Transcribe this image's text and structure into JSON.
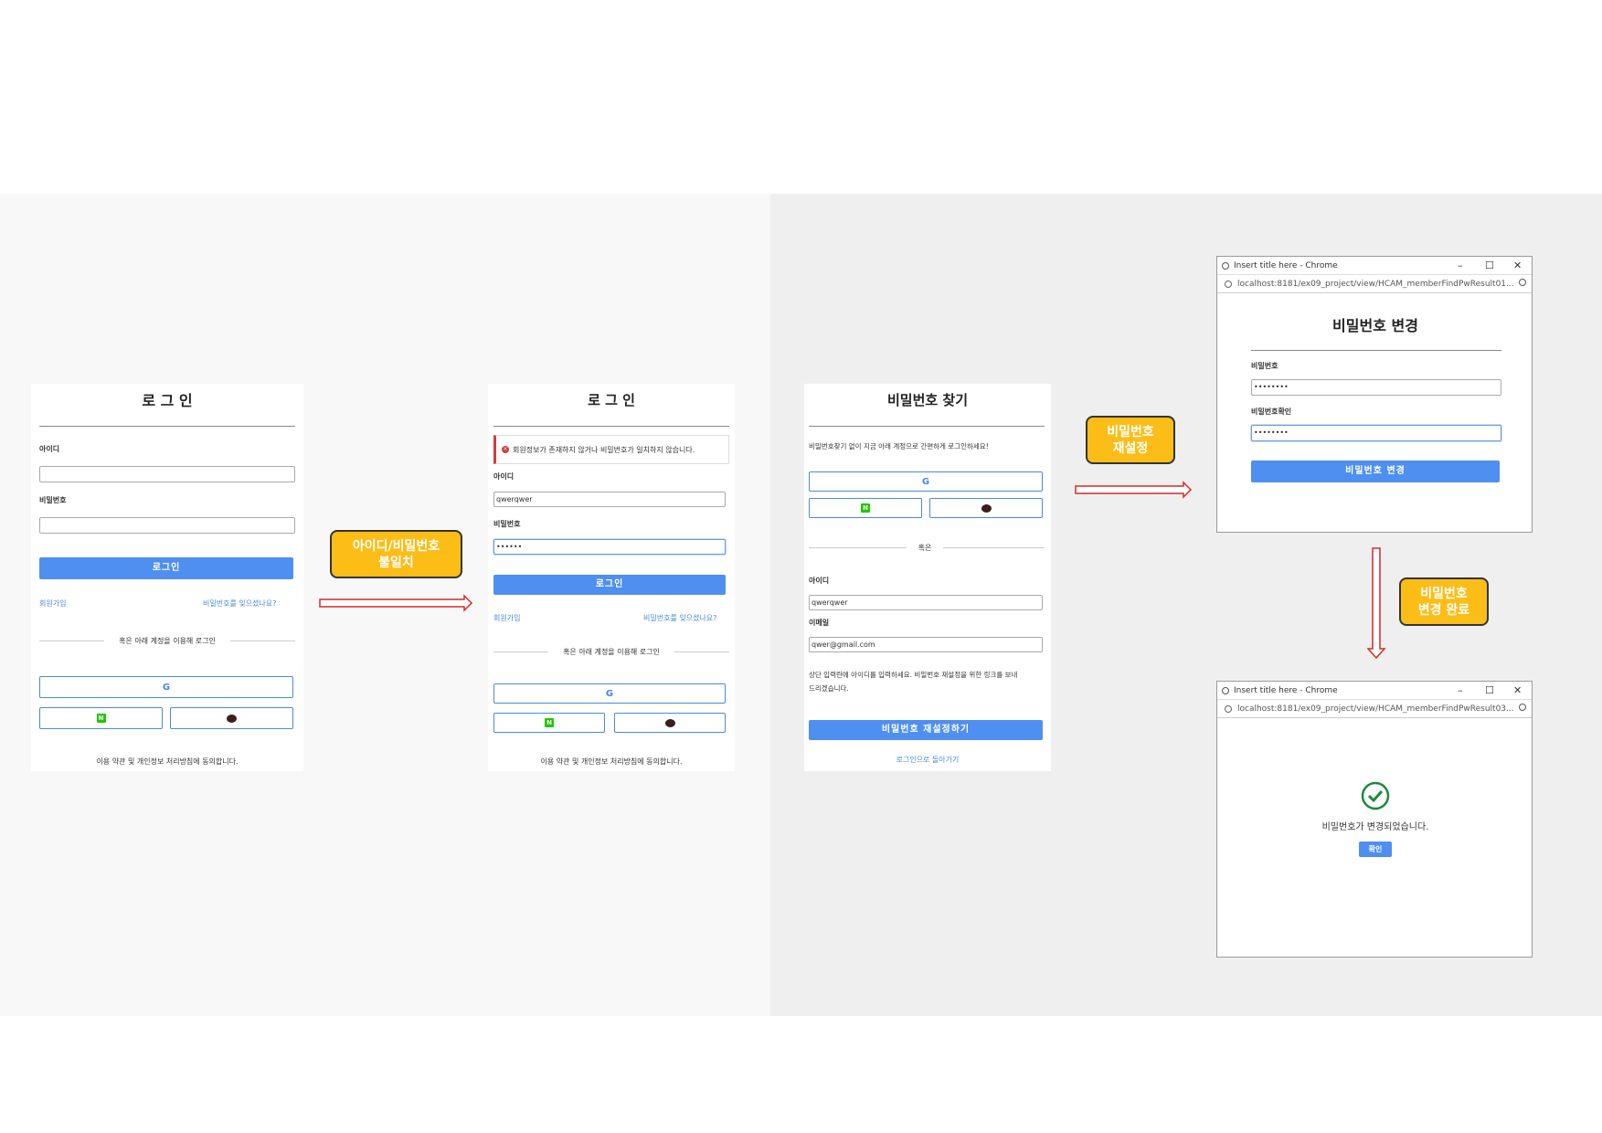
{
  "panel1": {
    "title": "로 그 인",
    "id_label": "아이디",
    "pw_label": "비밀번호",
    "login_button": "로그인",
    "signup_link": "회원가입",
    "forgot_link": "비밀번호를 잊으셨나요?",
    "or_text": "혹은 아래 계정을 이용해 로그인",
    "footer": "이용 약관 및 개인정보 처리방침에 동의합니다."
  },
  "panel2": {
    "title": "로 그 인",
    "error_message": "회원정보가 존재하지 않거나 비밀번호가 일치하지 않습니다.",
    "id_label": "아이디",
    "id_value": "qwerqwer",
    "pw_label": "비밀번호",
    "pw_value": "••••••",
    "login_button": "로그인",
    "signup_link": "회원가입",
    "forgot_link": "비밀번호를 잊으셨나요?",
    "or_text": "혹은 아래 계정을 이용해 로그인",
    "footer": "이용 약관 및 개인정보 처리방침에 동의합니다."
  },
  "panel3": {
    "title": "비밀번호 찾기",
    "description": "비밀번호찾기 없이 지금 아래 계정으로 간편하게 로그인하세요!",
    "or_text": "혹은",
    "id_label": "아이디",
    "id_value": "qwerqwer",
    "email_label": "이메일",
    "email_value": "qwer@gmail.com",
    "info_text_1": "상단 입력란에 아이디를 입력하세요. 비밀번호 재설정을 위한 링크를 보내",
    "info_text_2": "드리겠습니다.",
    "reset_button": "비밀번호 재설정하기",
    "back_link": "로그인으로 돌아가기"
  },
  "window1": {
    "title": "Insert title here - Chrome",
    "url": "localhost:8181/ex09_project/view/HCAM_memberFindPwResult01...",
    "heading": "비밀번호 변경",
    "pw_label": "비밀번호",
    "pw_value": "••••••••",
    "pw_confirm_label": "비밀번호확인",
    "pw_confirm_value": "••••••••",
    "change_button": "비밀번호 변경"
  },
  "window2": {
    "title": "Insert title here - Chrome",
    "url": "localhost:8181/ex09_project/view/HCAM_memberFindPwResult03...",
    "message": "비밀번호가 변경되었습니다.",
    "ok_button": "확인"
  },
  "callouts": {
    "mismatch_1": "아이디/비밀번호",
    "mismatch_2": "불일치",
    "reset_1": "비밀번호",
    "reset_2": "재설정",
    "done_1": "비밀번호",
    "done_2": "변경 완료"
  },
  "colors": {
    "accent_blue": "#4f8ff0",
    "callout_yellow": "#fdbd17",
    "arrow_red": "#d42a2a",
    "error_red": "#d53a3a",
    "success_green": "#1b8a3a"
  },
  "icons": [
    "google-icon",
    "naver-icon",
    "kakao-icon",
    "error-icon",
    "check-circle-icon",
    "info-icon",
    "zoom-icon",
    "chrome-icon"
  ]
}
